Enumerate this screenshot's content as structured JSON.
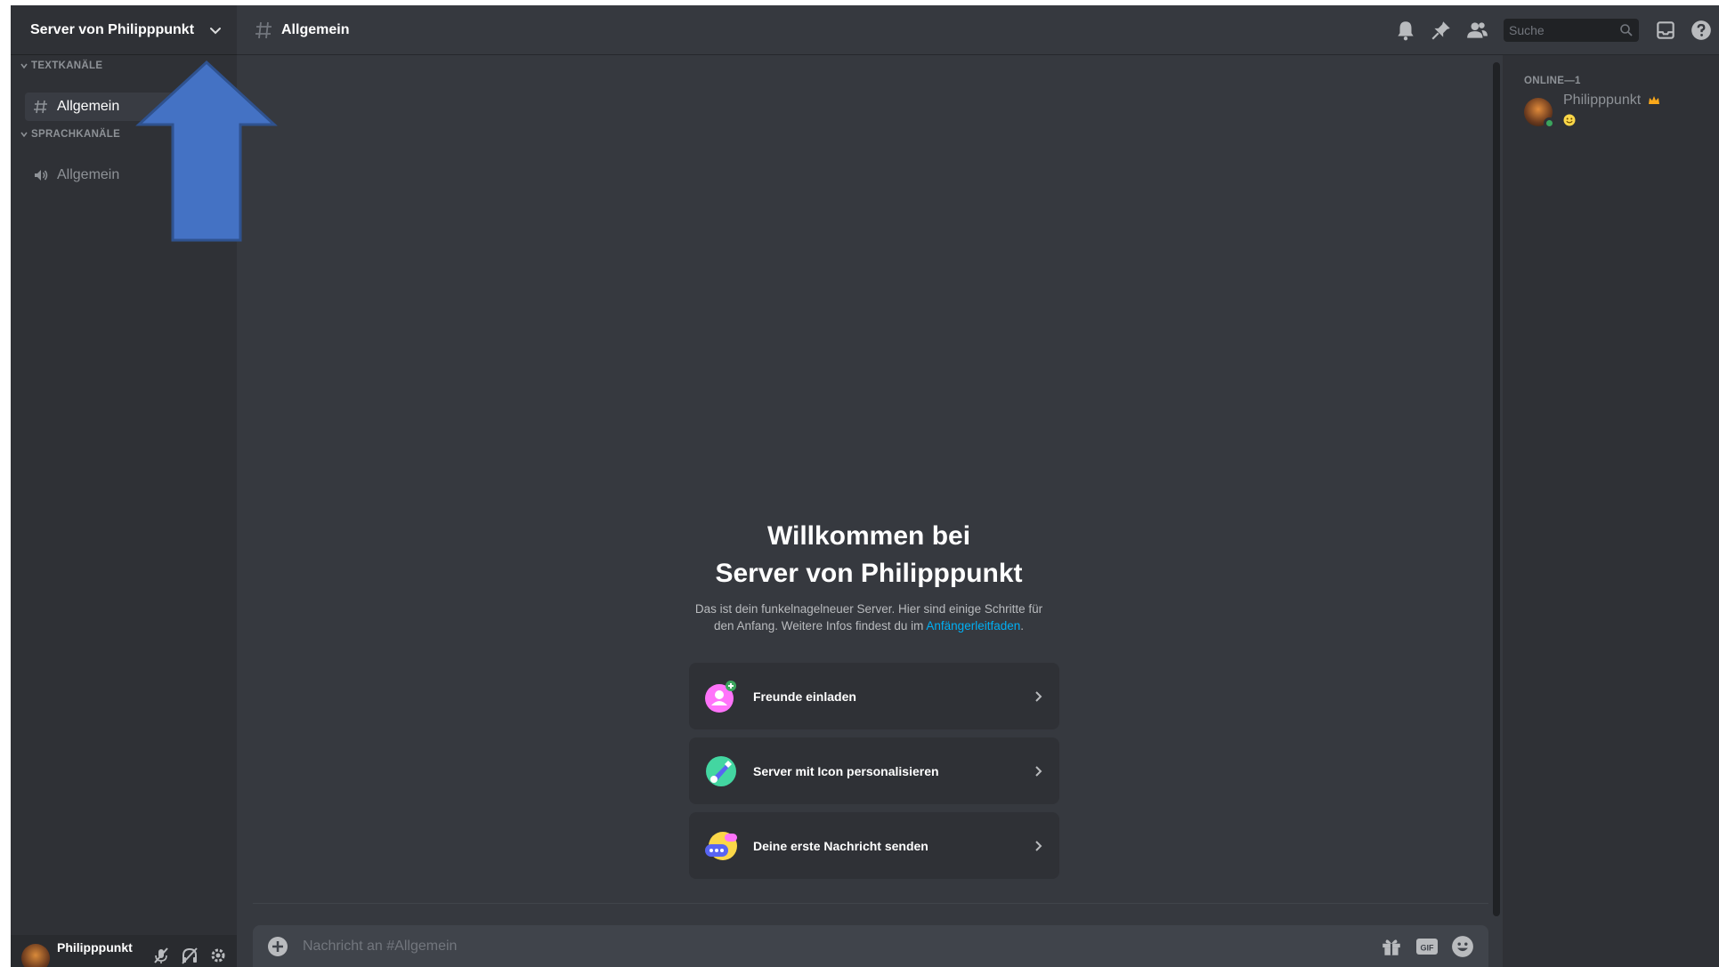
{
  "server": {
    "name": "Server von Philipppunkt"
  },
  "sidebar": {
    "categories": [
      {
        "label": "TEXTKANÄLE",
        "channels": [
          {
            "name": "Allgemein",
            "type": "text",
            "active": true
          }
        ]
      },
      {
        "label": "SPRACHKANÄLE",
        "channels": [
          {
            "name": "Allgemein",
            "type": "voice",
            "active": false
          }
        ]
      }
    ]
  },
  "header": {
    "channel_name": "Allgemein",
    "search_placeholder": "Suche",
    "icons": [
      "bell-icon",
      "pin-icon",
      "members-icon",
      "search-icon",
      "inbox-icon",
      "help-icon"
    ]
  },
  "welcome": {
    "title_line1": "Willkommen bei",
    "title_line2": "Server von Philipppunkt",
    "desc_line1": "Das ist dein funkelnagelneuer Server. Hier sind einige Schritte für",
    "desc_line2_prefix": "den Anfang. Weitere Infos findest du im",
    "desc_link": "Anfängerleitfaden",
    "desc_suffix": ".",
    "cards": [
      {
        "label": "Freunde einladen",
        "icon": "invite-friends-icon"
      },
      {
        "label": "Server mit Icon personalisieren",
        "icon": "personalize-icon"
      },
      {
        "label": "Deine erste Nachricht senden",
        "icon": "first-message-icon"
      }
    ]
  },
  "composer": {
    "placeholder": "Nachricht an #Allgemein"
  },
  "members": {
    "heading": "ONLINE—1",
    "list": [
      {
        "name": "Philipppunkt",
        "status": "online",
        "owner": true
      }
    ]
  },
  "user_panel": {
    "username": "Philipppunkt"
  },
  "colors": {
    "background": "#36393f",
    "sidebar": "#2f3136",
    "accent_link": "#00aff4",
    "online": "#3ba55d",
    "annotation_arrow": "#4472c4"
  }
}
